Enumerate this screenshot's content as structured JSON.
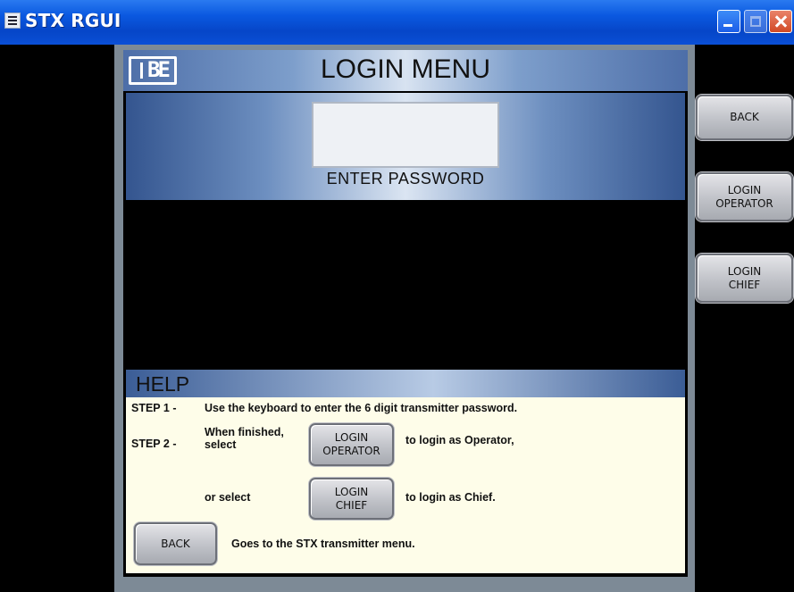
{
  "window": {
    "title": "STX RGUI"
  },
  "header": {
    "logo_text": "BE",
    "title": "LOGIN MENU"
  },
  "password": {
    "label": "ENTER PASSWORD",
    "value": ""
  },
  "side_buttons": {
    "back": "BACK",
    "login_operator": [
      "LOGIN",
      "OPERATOR"
    ],
    "login_chief": [
      "LOGIN",
      "CHIEF"
    ]
  },
  "help": {
    "title": "HELP",
    "step1_label": "STEP 1 -",
    "step1_text": "Use the keyboard to enter the 6 digit transmitter password.",
    "step2_label": "STEP 2 -",
    "step2_when": [
      "When finished,",
      "select"
    ],
    "step2_operator_btn": [
      "LOGIN",
      "OPERATOR"
    ],
    "step2_operator_text": "to login as Operator,",
    "or_select": "or select",
    "chief_btn": [
      "LOGIN",
      "CHIEF"
    ],
    "chief_text": "to login as Chief.",
    "back_btn": "BACK",
    "back_text": "Goes to the STX transmitter menu."
  }
}
